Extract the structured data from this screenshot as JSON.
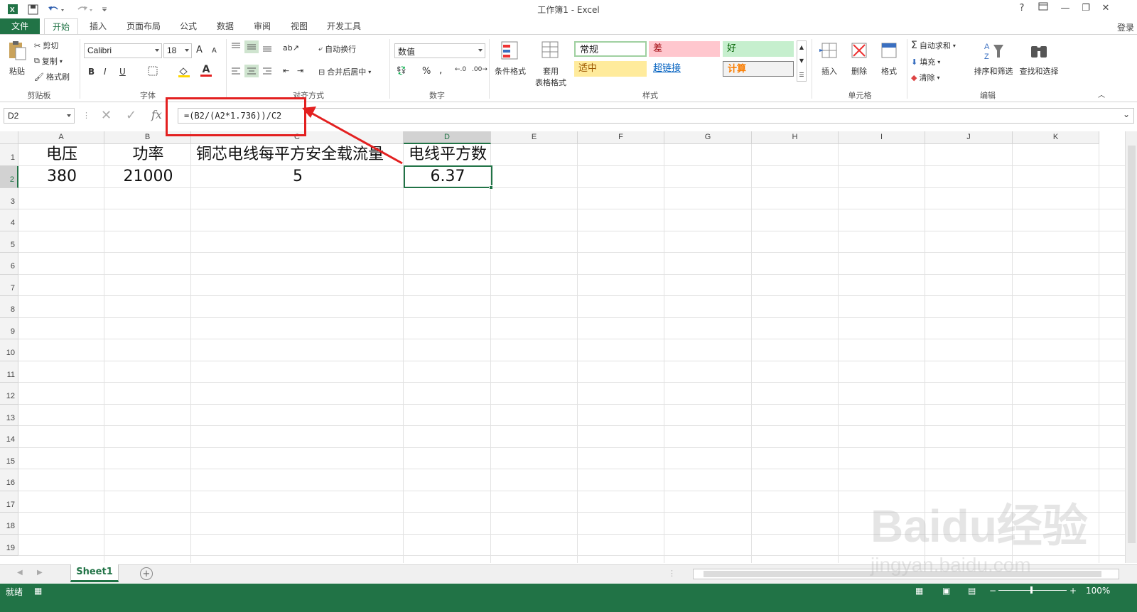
{
  "window": {
    "title": "工作簿1 - Excel",
    "login": "登录",
    "help": "?",
    "minimize": "—",
    "restore": "❐",
    "close": "✕"
  },
  "ribbon_tabs": [
    "文件",
    "开始",
    "插入",
    "页面布局",
    "公式",
    "数据",
    "审阅",
    "视图",
    "开发工具"
  ],
  "ribbon": {
    "clipboard": {
      "paste": "粘贴",
      "cut": "剪切",
      "copy": "复制",
      "format_painter": "格式刷",
      "group": "剪贴板"
    },
    "font": {
      "name": "Calibri",
      "size": "18",
      "grow": "A",
      "shrink": "A",
      "bold": "B",
      "italic": "I",
      "underline": "U",
      "font_color_glyph": "A",
      "group": "字体"
    },
    "alignment": {
      "wrap": "自动换行",
      "merge": "合并后居中",
      "group": "对齐方式"
    },
    "number": {
      "format": "数值",
      "percent": "%",
      "comma": ",",
      "group": "数字"
    },
    "styles": {
      "conditional": "条件格式",
      "table_format_1": "套用",
      "table_format_2": "表格格式",
      "normal": "常规",
      "bad": "差",
      "good": "好",
      "neutral": "适中",
      "hyperlink": "超链接",
      "calc": "计算",
      "group": "样式"
    },
    "cells": {
      "insert": "插入",
      "delete": "删除",
      "format": "格式",
      "group": "单元格"
    },
    "editing": {
      "autosum": "自动求和",
      "fill": "填充",
      "clear": "清除",
      "sort": "排序和筛选",
      "find": "查找和选择",
      "group": "编辑"
    }
  },
  "formula_bar": {
    "name_box": "D2",
    "fx": "fx",
    "formula": "=(B2/(A2*1.736))/C2"
  },
  "grid": {
    "columns": [
      "A",
      "B",
      "C",
      "D",
      "E",
      "F",
      "G",
      "H",
      "I",
      "J",
      "K"
    ],
    "rows": [
      "1",
      "2",
      "3",
      "4",
      "5",
      "6",
      "7",
      "8",
      "9",
      "10",
      "11",
      "12",
      "13",
      "14",
      "15",
      "16",
      "17",
      "18",
      "19"
    ],
    "cells": {
      "A1": "电压",
      "B1": "功率",
      "C1": "铜芯电线每平方安全载流量",
      "D1": "电线平方数",
      "A2": "380",
      "B2": "21000",
      "C2": "5",
      "D2": "6.37"
    },
    "active_cell": "D2"
  },
  "sheets": {
    "active": "Sheet1",
    "add": "+"
  },
  "status": {
    "ready": "就绪",
    "zoom": "100%",
    "zoom_minus": "−",
    "zoom_plus": "+"
  },
  "watermark": {
    "brand": "Baidu经验",
    "url": "jingyan.baidu.com"
  },
  "colors": {
    "excel_green": "#217346",
    "annotation_red": "#e32020"
  }
}
